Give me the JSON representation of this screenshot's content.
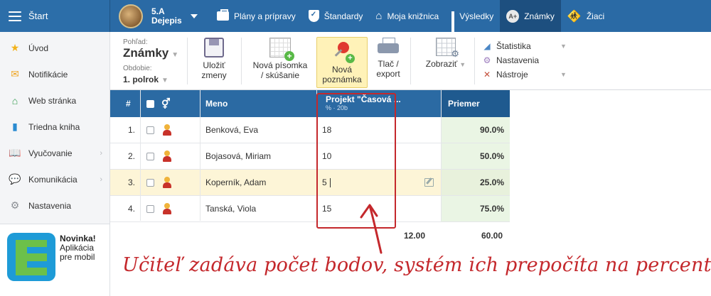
{
  "app": {
    "start_label": "Štart"
  },
  "class_selector": {
    "class": "5.A",
    "subject": "Dejepis"
  },
  "top_nav": [
    {
      "label": "Plány a prípravy",
      "icon": "briefcase-icon"
    },
    {
      "label": "Štandardy",
      "icon": "shield-icon"
    },
    {
      "label": "Moja knižnica",
      "icon": "library-icon"
    },
    {
      "label": "Výsledky",
      "icon": "bar-chart-icon"
    },
    {
      "label": "Známky",
      "icon": "grades-badge-icon",
      "active": true
    },
    {
      "label": "Žiaci",
      "icon": "students-icon"
    }
  ],
  "sidebar": {
    "items": [
      {
        "label": "Úvod",
        "icon": "star-icon",
        "color": "#f2b21b"
      },
      {
        "label": "Notifikácie",
        "icon": "envelope-icon",
        "color": "#f0a623"
      },
      {
        "label": "Web stránka",
        "icon": "home-icon",
        "color": "#2f9a4c"
      },
      {
        "label": "Triedna kniha",
        "icon": "book-icon",
        "color": "#2a8bd1"
      },
      {
        "label": "Vyučovanie",
        "icon": "open-book-icon",
        "color": "#2a6aa5",
        "submenu": true
      },
      {
        "label": "Komunikácia",
        "icon": "chat-icon",
        "color": "#d9392e",
        "submenu": true
      },
      {
        "label": "Nastavenia",
        "icon": "gear-icon",
        "color": "#8b8f94"
      }
    ],
    "promo": {
      "title": "Novinka!",
      "line1": "Aplikácia",
      "line2": "pre mobil"
    }
  },
  "toolbar": {
    "view_label": "Pohľad:",
    "view_value": "Známky",
    "period_label": "Obdobie:",
    "period_value": "1. polrok",
    "buttons": [
      {
        "line1": "Uložiť",
        "line2": "zmeny",
        "icon": "save-icon"
      },
      {
        "line1": "Nová písomka",
        "line2": "/ skúšanie",
        "icon": "new-test-icon"
      },
      {
        "line1": "Nová",
        "line2": "poznámka",
        "icon": "pin-icon",
        "highlighted": true
      },
      {
        "line1": "Tlač /",
        "line2": "export",
        "icon": "printer-icon"
      },
      {
        "line1": "Zobraziť",
        "line2": "",
        "icon": "grid-settings-icon"
      }
    ],
    "menu": [
      {
        "label": "Štatistika",
        "icon": "area-chart-icon"
      },
      {
        "label": "Nastavenia",
        "icon": "gears-icon"
      },
      {
        "label": "Nástroje",
        "icon": "tools-icon"
      }
    ]
  },
  "table": {
    "headers": {
      "num": "#",
      "name": "Meno",
      "project": "Projekt \"Časová ...",
      "project_sub": "% · 20b",
      "average": "Priemer"
    },
    "rows": [
      {
        "num": "1.",
        "name": "Benková, Eva",
        "score": "18",
        "average": "90.0%"
      },
      {
        "num": "2.",
        "name": "Bojasová, Miriam",
        "score": "10",
        "average": "50.0%"
      },
      {
        "num": "3.",
        "name": "Koperník, Adam",
        "score": "5",
        "average": "25.0%",
        "editing": true
      },
      {
        "num": "4.",
        "name": "Tanská, Viola",
        "score": "15",
        "average": "75.0%"
      }
    ],
    "totals": {
      "project": "12.00",
      "average": "60.00"
    }
  },
  "annotation": {
    "text": "Učiteľ zadáva počet bodov, systém ich prepočíta na percentá",
    "color": "#c4282c"
  }
}
